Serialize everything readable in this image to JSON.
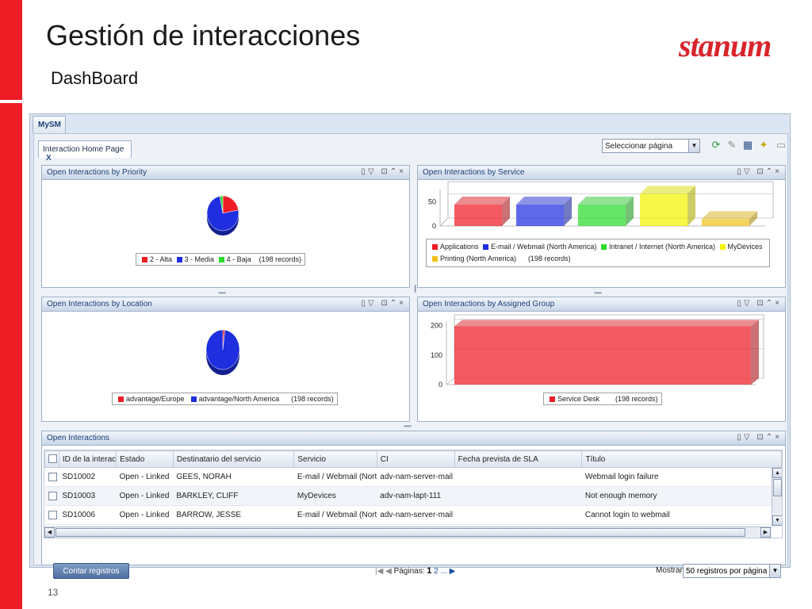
{
  "slide": {
    "title": "Gestión de interacciones",
    "subtitle": "DashBoard",
    "logo": "stanum",
    "page_number": "13",
    "accent_color": "#ee1c25"
  },
  "app": {
    "top_tab": "MySM",
    "sub_tab": "Interaction Home Page",
    "sub_tab_close": "X",
    "page_select": "Seleccionar página",
    "toolbar_icons": [
      "refresh-icon",
      "edit-icon",
      "layout-icon",
      "new-page-icon",
      "page-icon"
    ]
  },
  "panels": {
    "priority": {
      "title": "Open Interactions by Priority",
      "legend": [
        "2 - Alta",
        "3 - Media",
        "4 - Baja"
      ],
      "records": "(198 records)"
    },
    "service": {
      "title": "Open Interactions by Service",
      "legend": [
        "Applications",
        "E-mail / Webmail (North America)",
        "Intranet / Internet (North America)",
        "MyDevices",
        "Printing (North America)"
      ],
      "records": "(198 records)",
      "ticks": [
        "50",
        "0"
      ]
    },
    "location": {
      "title": "Open Interactions by Location",
      "legend": [
        "advantage/Europe",
        "advantage/North America"
      ],
      "records": "(198 records)"
    },
    "group": {
      "title": "Open Interactions by Assigned Group",
      "legend": [
        "Service Desk"
      ],
      "records": "(198 records)",
      "ticks": [
        "200",
        "100",
        "0"
      ]
    },
    "open": {
      "title": "Open Interactions"
    }
  },
  "chart_data": [
    {
      "type": "pie",
      "title": "Open Interactions by Priority",
      "categories": [
        "2 - Alta",
        "3 - Media",
        "4 - Baja"
      ],
      "values": [
        22,
        75,
        3
      ],
      "colors": [
        "#ee1c25",
        "#1f2fe0",
        "#2bdc2b"
      ]
    },
    {
      "type": "bar",
      "title": "Open Interactions by Service",
      "categories": [
        "Applications",
        "E-mail / Webmail (North America)",
        "Intranet / Internet (North America)",
        "MyDevices",
        "Printing (North America)"
      ],
      "values": [
        44,
        44,
        44,
        66,
        14
      ],
      "ylim": [
        0,
        75
      ],
      "colors": [
        "#ee1c25",
        "#1f2fe0",
        "#2bdc2b",
        "#f4f400",
        "#f2c21a"
      ]
    },
    {
      "type": "pie",
      "title": "Open Interactions by Location",
      "categories": [
        "advantage/Europe",
        "advantage/North America"
      ],
      "values": [
        2,
        98
      ],
      "colors": [
        "#ee1c25",
        "#1f2fe0"
      ]
    },
    {
      "type": "bar",
      "title": "Open Interactions by Assigned Group",
      "categories": [
        "Service Desk"
      ],
      "values": [
        198
      ],
      "ylim": [
        0,
        215
      ],
      "colors": [
        "#ee1c25"
      ]
    }
  ],
  "table": {
    "headers": [
      "ID de la interac",
      "Estado",
      "Destinatario del servicio",
      "Servicio",
      "CI",
      "Fecha prevista de SLA",
      "Título"
    ],
    "rows": [
      [
        "SD10002",
        "Open - Linked",
        "GEES, NORAH",
        "E-mail / Webmail (Nort",
        "adv-nam-server-mail",
        "",
        "Webmail login failure"
      ],
      [
        "SD10003",
        "Open - Linked",
        "BARKLEY, CLIFF",
        "MyDevices",
        "adv-nam-lapt-111",
        "",
        "Not enough memory"
      ],
      [
        "SD10006",
        "Open - Linked",
        "BARROW, JESSE",
        "E-mail / Webmail (Nort",
        "adv-nam-server-mail",
        "",
        "Cannot login to webmail"
      ]
    ]
  },
  "footer": {
    "count_button": "Contar registros",
    "pages_label": "Páginas:",
    "current_page": "1",
    "next_page": "2",
    "ellipsis": "...",
    "show_label": "Mostrar",
    "rows_per_page": "50 registros por página"
  }
}
